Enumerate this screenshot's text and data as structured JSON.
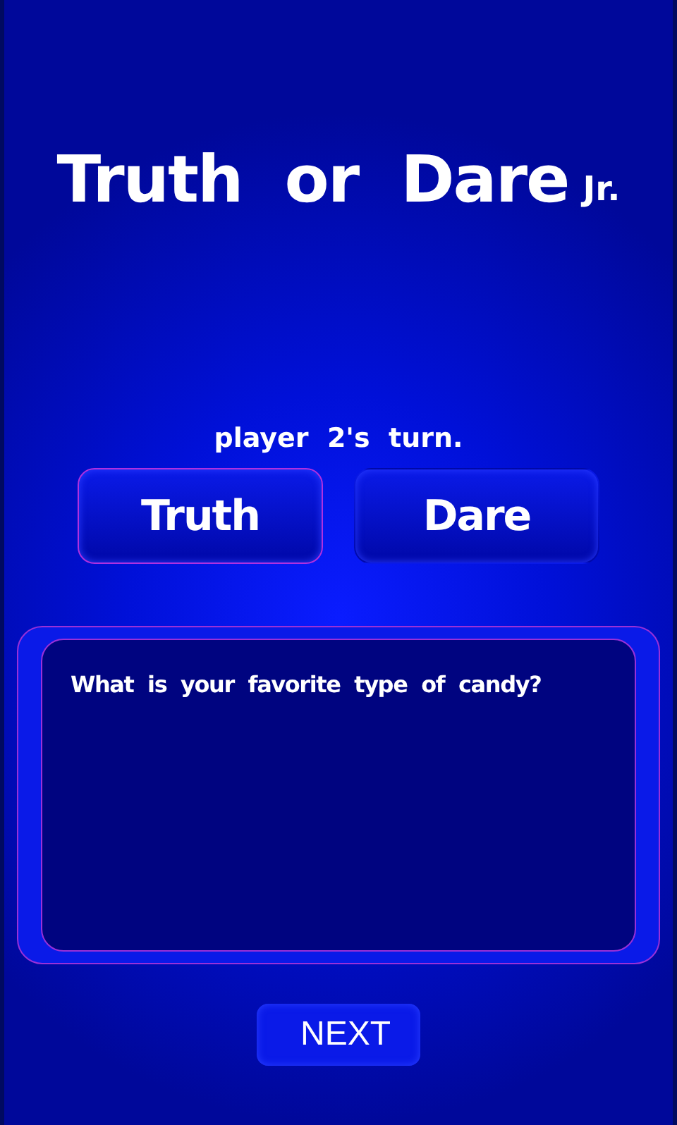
{
  "title": {
    "main": "Truth  or  Dare",
    "suffix": "Jr."
  },
  "turn": "player  2's  turn.",
  "choices": [
    {
      "label": "Truth",
      "selected": true
    },
    {
      "label": "Dare",
      "selected": false
    }
  ],
  "question": "What is your favorite type of candy?",
  "next_button": "NEXT"
}
